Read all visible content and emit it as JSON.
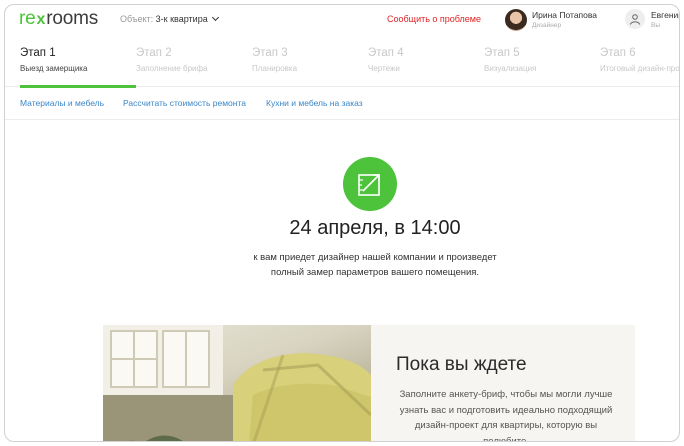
{
  "header": {
    "logo": {
      "prefix": "re",
      "mark": "x",
      "suffix": "rooms"
    },
    "object_label": "Объект:",
    "object_value": "3-к квартира",
    "report_problem": "Сообщить о проблеме",
    "designer": {
      "name": "Ирина Потапова",
      "role": "Дизайнер"
    },
    "user": {
      "name": "Евгений",
      "role": "Вы"
    }
  },
  "steps": [
    {
      "num": "Этап 1",
      "label": "Выезд замерщика",
      "active": true
    },
    {
      "num": "Этап 2",
      "label": "Заполнение брифа",
      "active": false
    },
    {
      "num": "Этап 3",
      "label": "Планировка",
      "active": false
    },
    {
      "num": "Этап 4",
      "label": "Чертежи",
      "active": false
    },
    {
      "num": "Этап 5",
      "label": "Визуализация",
      "active": false
    },
    {
      "num": "Этап 6",
      "label": "Итоговый дизайн-проект",
      "active": false
    }
  ],
  "links": [
    "Материалы и мебель",
    "Рассчитать стоимость ремонта",
    "Кухни и мебель на заказ"
  ],
  "main": {
    "date": "24 апреля, в 14:00",
    "description_line1": "к вам приедет дизайнер нашей компании и произведет",
    "description_line2": "полный замер параметров вашего помещения."
  },
  "card": {
    "title": "Пока вы ждете",
    "text": "Заполните анкету-бриф, чтобы мы могли лучше узнать вас и подготовить идеально подходящий дизайн-проект для квартиры, которую вы полюбите."
  },
  "colors": {
    "accent": "#4cc33a",
    "link": "#3a86c8",
    "danger": "#e12323"
  }
}
